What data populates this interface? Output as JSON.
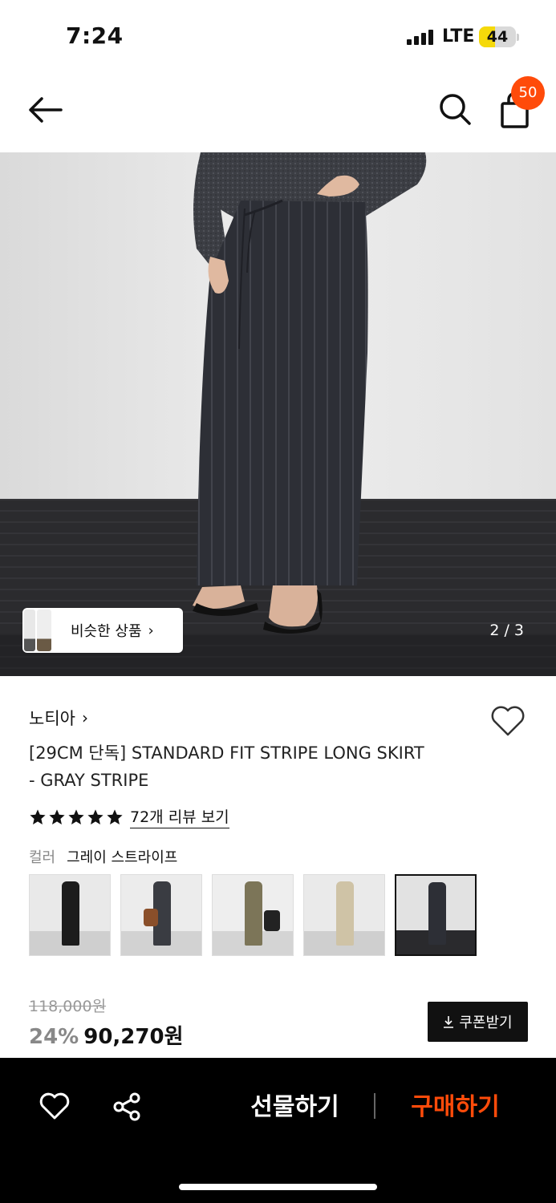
{
  "status_bar": {
    "time": "7:24",
    "network": "LTE",
    "battery": "44"
  },
  "header": {
    "back_icon": "arrow-left-icon",
    "search_icon": "search-icon",
    "cart_icon": "shopping-bag-icon",
    "cart_count": "50"
  },
  "hero": {
    "similar_label": "비슷한 상품",
    "page_indicator": "2 / 3"
  },
  "product": {
    "brand": "노티아",
    "title_line1": "[29CM 단독] STANDARD FIT STRIPE LONG SKIRT",
    "title_line2": "- GRAY STRIPE",
    "rating": 5,
    "review_link": "72개 리뷰 보기",
    "color_label": "컬러",
    "color_value": "그레이 스트라이프"
  },
  "price": {
    "original": "118,000원",
    "discount": "24%",
    "final": "90,270원",
    "coupon_label": "쿠폰받기"
  },
  "bottom_bar": {
    "gift_label": "선물하기",
    "buy_label": "구매하기"
  },
  "colors": {
    "accent": "#ff4b0a",
    "battery": "#f5d90a"
  }
}
